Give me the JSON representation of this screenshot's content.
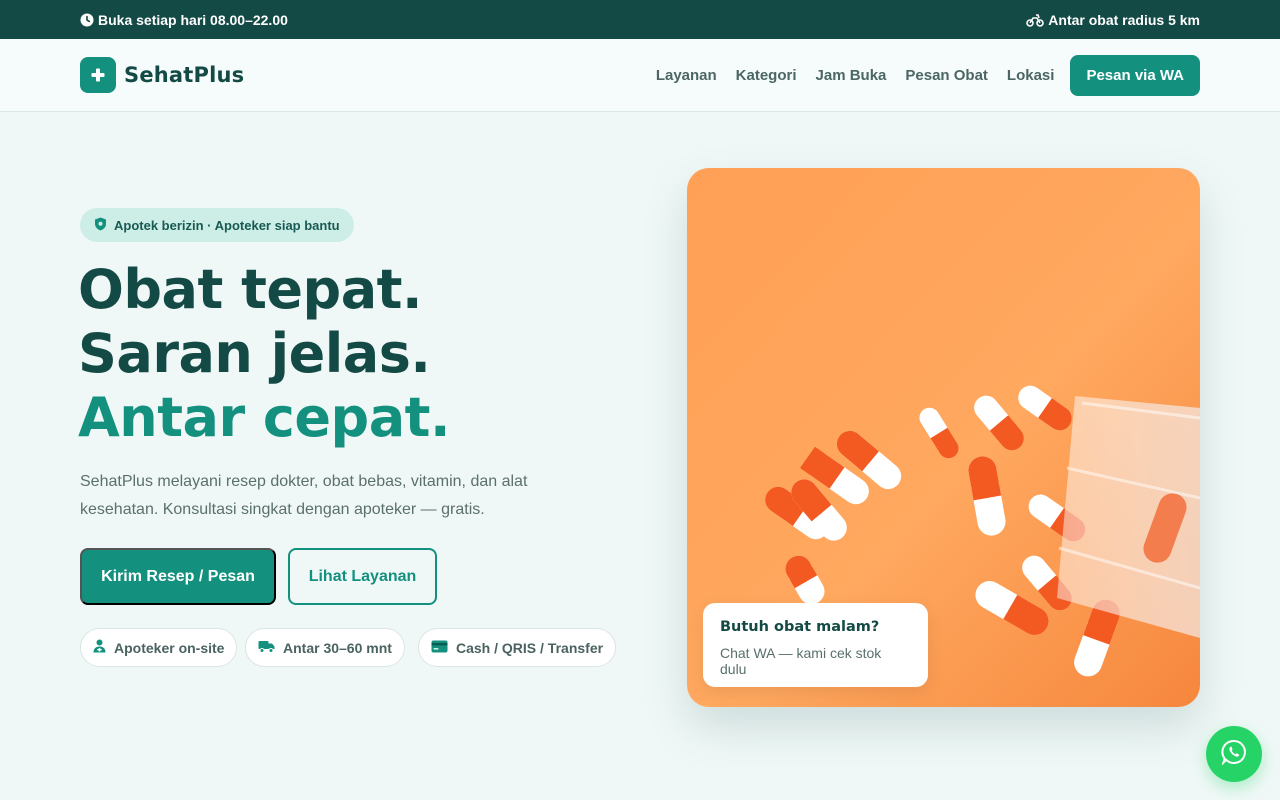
{
  "topbar": {
    "hours": "Buka setiap hari 08.00–22.00",
    "delivery": "Antar obat radius 5 km"
  },
  "brand": {
    "name": "SehatPlus"
  },
  "nav": {
    "items": [
      "Layanan",
      "Kategori",
      "Jam Buka",
      "Pesan Obat",
      "Lokasi"
    ],
    "cta": "Pesan via WA"
  },
  "hero": {
    "badge": "Apotek berizin · Apoteker siap bantu",
    "headline": [
      "Obat tepat.",
      "Saran jelas.",
      "Antar cepat."
    ],
    "description": "SehatPlus melayani resep dokter, obat bebas, vitamin, dan alat kesehatan. Konsultasi singkat dengan apoteker — gratis.",
    "cta_primary": "Kirim Resep / Pesan",
    "cta_secondary": "Lihat Layanan",
    "chips": [
      "Apoteker on-site",
      "Antar 30–60 mnt",
      "Cash / QRIS / Transfer"
    ]
  },
  "float_card": {
    "title": "Butuh obat malam?",
    "subtitle": "Chat WA — kami cek stok dulu"
  },
  "icons": {
    "clock": "clock-icon",
    "delivery": "motorbike-icon",
    "brand": "plus-icon",
    "badge": "shield-icon",
    "pharmacist": "pharmacist-icon",
    "truck": "truck-icon",
    "payment": "card-icon",
    "whatsapp": "whatsapp-icon"
  },
  "colors": {
    "topbar": "#144a45",
    "primary": "#14907f",
    "heading": "#144a45",
    "badge_bg": "#cdeee6",
    "whatsapp": "#25d366",
    "image_bg": "#ffa45c"
  }
}
